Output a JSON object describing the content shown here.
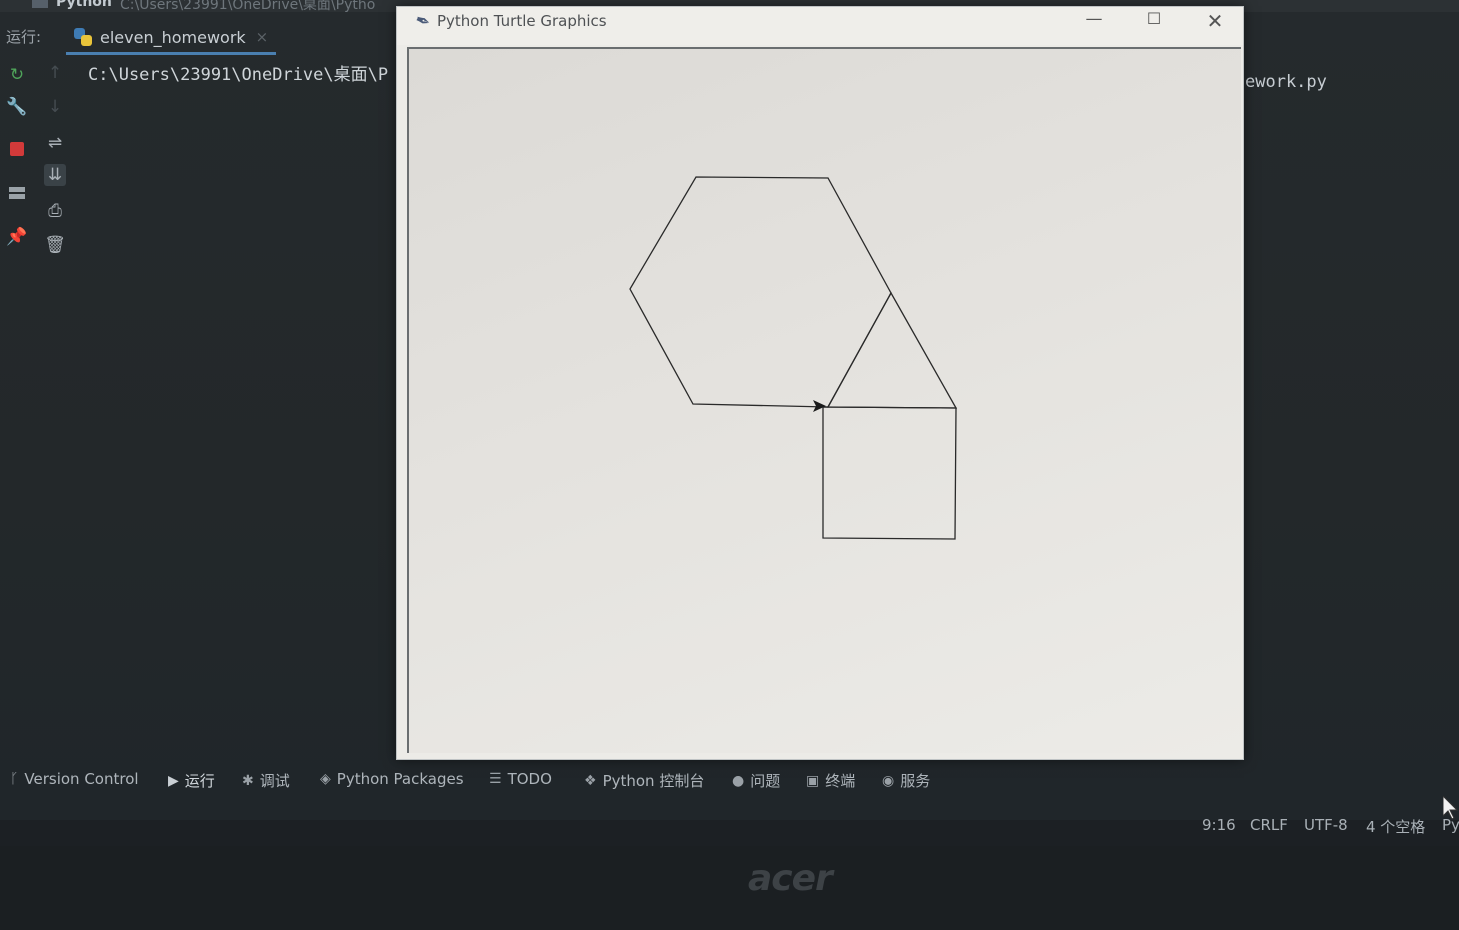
{
  "ide": {
    "title_app": "Python",
    "title_path": "C:\\Users\\23991\\OneDrive\\桌面\\Pytho",
    "run_label": "运行:",
    "run_tab": "eleven_homework",
    "console_line": "C:\\Users\\23991\\OneDrive\\桌面\\P",
    "console_tail": "ework.py"
  },
  "bottom_tabs": {
    "version_control": "Version Control",
    "run": "运行",
    "debug": "调试",
    "python_packages": "Python Packages",
    "todo": "TODO",
    "python_console": "Python 控制台",
    "problems": "问题",
    "terminal": "终端",
    "services": "服务"
  },
  "status": {
    "position": "9:16",
    "line_sep": "CRLF",
    "encoding": "UTF-8",
    "indent": "4 个空格",
    "interpreter_prefix": "Py"
  },
  "turtle_window": {
    "title": "Python Turtle Graphics",
    "min_label": "—",
    "max_label": "☐",
    "close_label": "✕"
  },
  "laptop": {
    "brand": "acer"
  },
  "icons": {
    "rerun": "rerun-icon",
    "wrench": "wrench-icon",
    "stop": "stop-icon",
    "layout": "layout-icon",
    "pin": "pin-icon",
    "up": "up-arrow-icon",
    "down": "down-arrow-icon",
    "soft_wrap": "soft-wrap-icon",
    "scroll_end": "scroll-to-end-icon",
    "print": "print-icon",
    "trash": "trash-icon"
  },
  "colors": {
    "ide_bg": "#23282a",
    "stop_red": "#d23a3a",
    "rerun_green": "#4fa45a",
    "tab_underline": "#4a7fb0",
    "turtle_canvas": "#e6e4e0",
    "turtle_line": "#2a2a2a"
  }
}
